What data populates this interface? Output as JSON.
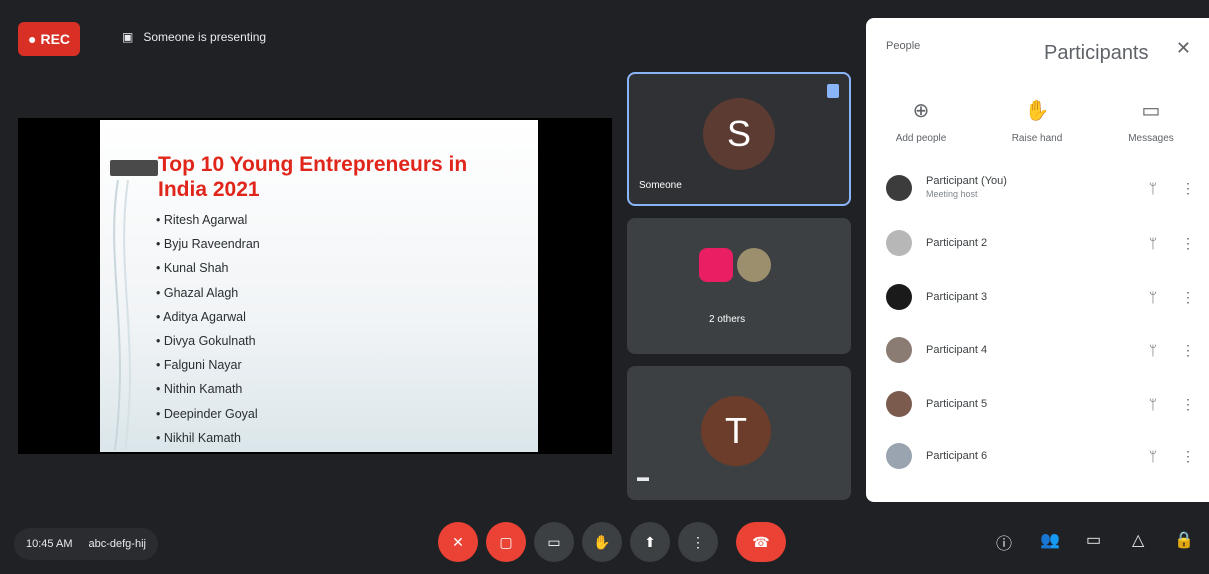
{
  "topbar": {
    "rec_label": "REC",
    "presenter_label": "Someone is presenting"
  },
  "slide": {
    "title": "Top 10 Young Entrepreneurs in India 2021",
    "bullets": [
      "Ritesh Agarwal",
      "Byju Raveendran",
      "Kunal Shah",
      "Ghazal Alagh",
      "Aditya Agarwal",
      "Divya Gokulnath",
      "Falguni Nayar",
      "Nithin Kamath",
      "Deepinder Goyal",
      "Nikhil Kamath"
    ]
  },
  "tiles": [
    {
      "initial": "S",
      "name": "Someone",
      "avatar_color": "#5c3b32"
    },
    {
      "name": "2 others"
    },
    {
      "initial": "T",
      "avatar_color": "#6d3d2b"
    }
  ],
  "panel": {
    "header": "People",
    "title": "Participants",
    "close": "✕",
    "options": [
      {
        "icon": "add-person-icon",
        "glyph": "⊕",
        "label": "Add people"
      },
      {
        "icon": "hand-icon",
        "glyph": "✋",
        "label": "Raise hand"
      },
      {
        "icon": "chat-icon",
        "glyph": "▭",
        "label": "Messages"
      }
    ],
    "participants": [
      {
        "name": "Participant (You)",
        "sub": "Meeting host",
        "color": "#3c3c3c"
      },
      {
        "name": "Participant 2",
        "sub": "",
        "color": "#b7b7b7"
      },
      {
        "name": "Participant 3",
        "sub": "",
        "color": "#1a1a1a"
      },
      {
        "name": "Participant 4",
        "sub": "",
        "color": "#8a7b73"
      },
      {
        "name": "Participant 5",
        "sub": "",
        "color": "#7a5b4e"
      },
      {
        "name": "Participant 6",
        "sub": "",
        "color": "#9aa4b0"
      }
    ]
  },
  "bottombar": {
    "time": "10:45 AM",
    "meeting_code": "abc-defg-hij",
    "controls": [
      "mic-off-icon",
      "camera-off-icon",
      "captions-icon",
      "hand-icon",
      "present-icon",
      "more-icon",
      "end-call-icon"
    ],
    "right": [
      "info-icon",
      "people-icon",
      "chat-icon",
      "activities-icon",
      "lock-icon"
    ]
  }
}
